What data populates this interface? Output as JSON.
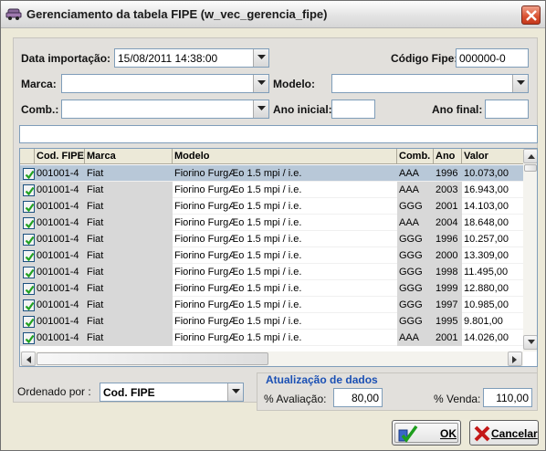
{
  "window": {
    "title": "Gerenciamento da tabela FIPE (w_vec_gerencia_fipe)"
  },
  "filters": {
    "data_importacao_label": "Data importação:",
    "data_importacao_value": "15/08/2011 14:38:00",
    "codigo_fipe_label": "Código Fipe:",
    "codigo_fipe_value": "000000-0",
    "marca_label": "Marca:",
    "marca_value": "",
    "modelo_label": "Modelo:",
    "modelo_value": "",
    "comb_label": "Comb.:",
    "comb_value": "",
    "ano_inicial_label": "Ano inicial:",
    "ano_inicial_value": "",
    "ano_final_label": "Ano final:",
    "ano_final_value": ""
  },
  "grid": {
    "headers": [
      "Cod. FIPE",
      "Marca",
      "Modelo",
      "Comb.",
      "Ano",
      "Valor"
    ],
    "rows": [
      {
        "cod": "001001-4",
        "marca": "Fiat",
        "modelo": "Fiorino FurgÆo 1.5 mpi / i.e.",
        "comb": "AAA",
        "ano": "1996",
        "valor": "10.073,00"
      },
      {
        "cod": "001001-4",
        "marca": "Fiat",
        "modelo": "Fiorino FurgÆo 1.5 mpi / i.e.",
        "comb": "AAA",
        "ano": "2003",
        "valor": "16.943,00"
      },
      {
        "cod": "001001-4",
        "marca": "Fiat",
        "modelo": "Fiorino FurgÆo 1.5 mpi / i.e.",
        "comb": "GGG",
        "ano": "2001",
        "valor": "14.103,00"
      },
      {
        "cod": "001001-4",
        "marca": "Fiat",
        "modelo": "Fiorino FurgÆo 1.5 mpi / i.e.",
        "comb": "AAA",
        "ano": "2004",
        "valor": "18.648,00"
      },
      {
        "cod": "001001-4",
        "marca": "Fiat",
        "modelo": "Fiorino FurgÆo 1.5 mpi / i.e.",
        "comb": "GGG",
        "ano": "1996",
        "valor": "10.257,00"
      },
      {
        "cod": "001001-4",
        "marca": "Fiat",
        "modelo": "Fiorino FurgÆo 1.5 mpi / i.e.",
        "comb": "GGG",
        "ano": "2000",
        "valor": "13.309,00"
      },
      {
        "cod": "001001-4",
        "marca": "Fiat",
        "modelo": "Fiorino FurgÆo 1.5 mpi / i.e.",
        "comb": "GGG",
        "ano": "1998",
        "valor": "11.495,00"
      },
      {
        "cod": "001001-4",
        "marca": "Fiat",
        "modelo": "Fiorino FurgÆo 1.5 mpi / i.e.",
        "comb": "GGG",
        "ano": "1999",
        "valor": "12.880,00"
      },
      {
        "cod": "001001-4",
        "marca": "Fiat",
        "modelo": "Fiorino FurgÆo 1.5 mpi / i.e.",
        "comb": "GGG",
        "ano": "1997",
        "valor": "10.985,00"
      },
      {
        "cod": "001001-4",
        "marca": "Fiat",
        "modelo": "Fiorino FurgÆo 1.5 mpi / i.e.",
        "comb": "GGG",
        "ano": "1995",
        "valor": "9.801,00"
      },
      {
        "cod": "001001-4",
        "marca": "Fiat",
        "modelo": "Fiorino FurgÆo 1.5 mpi / i.e.",
        "comb": "AAA",
        "ano": "2001",
        "valor": "14.026,00"
      }
    ]
  },
  "footer": {
    "ordenado_label": "Ordenado por :",
    "ordenado_value": "Cod. FIPE",
    "atualizacao_title": "Atualização de dados",
    "avaliacao_label": "% Avaliação:",
    "avaliacao_value": "80,00",
    "venda_label": "% Venda:",
    "venda_value": "110,00",
    "ok_label": "OK",
    "cancelar_label": "Cancelar"
  },
  "colors": {
    "selected_row": "#b8c8d8",
    "section_title": "#1b50b4",
    "checkbox_check": "#21a121"
  },
  "icons": [
    "car-icon",
    "close-icon",
    "chevron-down-icon",
    "checkbox-checked-icon",
    "scroll-up-icon",
    "scroll-down-icon",
    "scroll-left-icon",
    "scroll-right-icon",
    "check-ok-icon",
    "cancel-x-icon"
  ]
}
